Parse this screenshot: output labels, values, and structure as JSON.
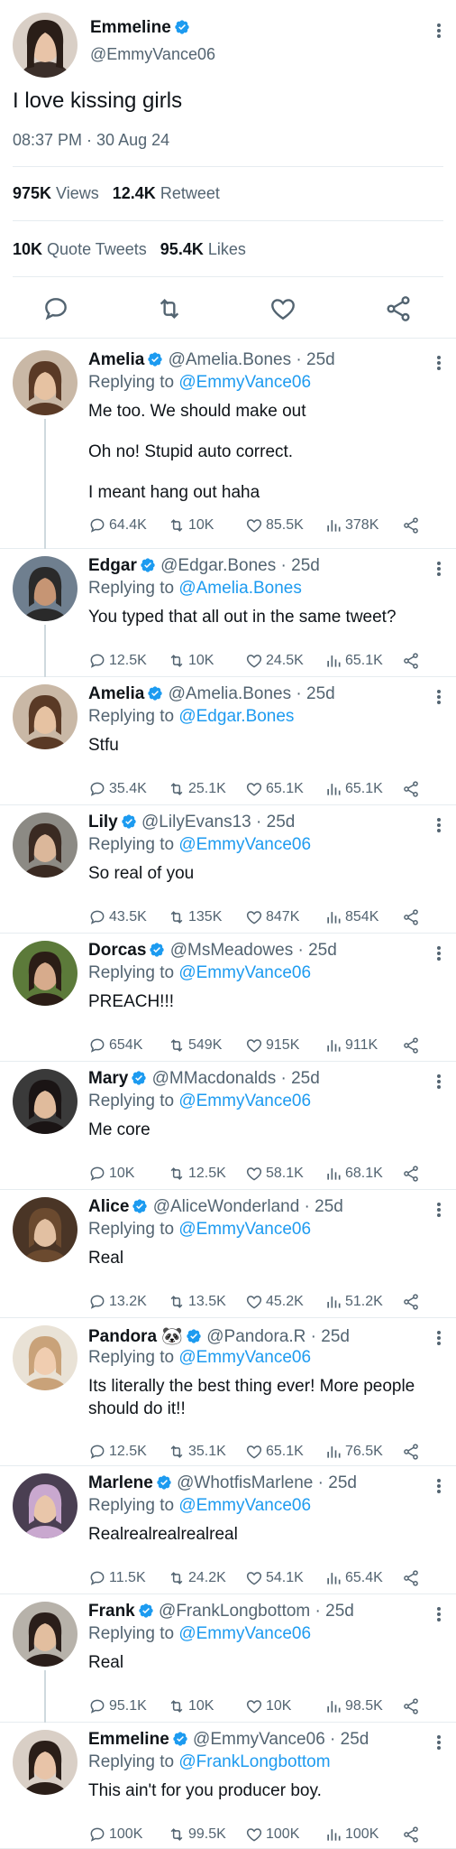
{
  "main": {
    "name": "Emmeline",
    "handle": "@EmmyVance06",
    "text": "I love kissing girls",
    "time": "08:37 PM · 30 Aug 24",
    "views": "975K",
    "views_label": "Views",
    "retweets": "12.4K",
    "retweets_label": "Retweet",
    "quotes": "10K",
    "quotes_label": "Quote Tweets",
    "likes": "95.4K",
    "likes_label": "Likes"
  },
  "replying_label": "Replying to",
  "replies": [
    {
      "name": "Amelia",
      "handle": "@Amelia.Bones",
      "age": "25d",
      "to": "@EmmyVance06",
      "lines": [
        "Me too. We should make out",
        "Oh no! Stupid auto correct.",
        "I meant hang out haha"
      ],
      "comments": "64.4K",
      "retweets": "10K",
      "likes": "85.5K",
      "views": "378K"
    },
    {
      "name": "Edgar",
      "handle": "@Edgar.Bones",
      "age": "25d",
      "to": "@Amelia.Bones",
      "lines": [
        "You typed that all out in the same tweet?"
      ],
      "comments": "12.5K",
      "retweets": "10K",
      "likes": "24.5K",
      "views": "65.1K"
    },
    {
      "name": "Amelia",
      "handle": "@Amelia.Bones",
      "age": "25d",
      "to": "@Edgar.Bones",
      "lines": [
        "Stfu"
      ],
      "comments": "35.4K",
      "retweets": "25.1K",
      "likes": "65.1K",
      "views": "65.1K"
    },
    {
      "name": "Lily",
      "handle": "@LilyEvans13",
      "age": "25d",
      "to": "@EmmyVance06",
      "lines": [
        "So real of you"
      ],
      "comments": "43.5K",
      "retweets": "135K",
      "likes": "847K",
      "views": "854K"
    },
    {
      "name": "Dorcas",
      "handle": "@MsMeadowes",
      "age": "25d",
      "to": "@EmmyVance06",
      "lines": [
        "PREACH!!!"
      ],
      "comments": "654K",
      "retweets": "549K",
      "likes": "915K",
      "views": "911K"
    },
    {
      "name": "Mary",
      "handle": "@MMacdonalds",
      "age": "25d",
      "to": "@EmmyVance06",
      "lines": [
        "Me core"
      ],
      "comments": "10K",
      "retweets": "12.5K",
      "likes": "58.1K",
      "views": "68.1K"
    },
    {
      "name": "Alice",
      "handle": "@AliceWonderland",
      "age": "25d",
      "to": "@EmmyVance06",
      "lines": [
        "Real"
      ],
      "comments": "13.2K",
      "retweets": "13.5K",
      "likes": "45.2K",
      "views": "51.2K"
    },
    {
      "name": "Pandora",
      "emoji": "🐼",
      "handle": "@Pandora.R",
      "age": "25d",
      "to": "@EmmyVance06",
      "lines": [
        "Its literally the best thing ever! More people should do it!!"
      ],
      "comments": "12.5K",
      "retweets": "35.1K",
      "likes": "65.1K",
      "views": "76.5K"
    },
    {
      "name": "Marlene",
      "handle": "@WhotfisMarlene",
      "age": "25d",
      "to": "@EmmyVance06",
      "lines": [
        "Realrealrealrealreal"
      ],
      "comments": "11.5K",
      "retweets": "24.2K",
      "likes": "54.1K",
      "views": "65.4K"
    },
    {
      "name": "Frank",
      "handle": "@FrankLongbottom",
      "age": "25d",
      "to": "@EmmyVance06",
      "lines": [
        "Real"
      ],
      "comments": "95.1K",
      "retweets": "10K",
      "likes": "10K",
      "views": "98.5K"
    },
    {
      "name": "Emmeline",
      "handle": "@EmmyVance06",
      "age": "25d",
      "to": "@FrankLongbottom",
      "lines": [
        "This ain't for you producer boy."
      ],
      "comments": "100K",
      "retweets": "99.5K",
      "likes": "100K",
      "views": "100K"
    }
  ],
  "colors": {
    "accent": "#1d9bf0",
    "text": "#0f1419",
    "muted": "#536471",
    "divider": "#e6ecf0"
  }
}
